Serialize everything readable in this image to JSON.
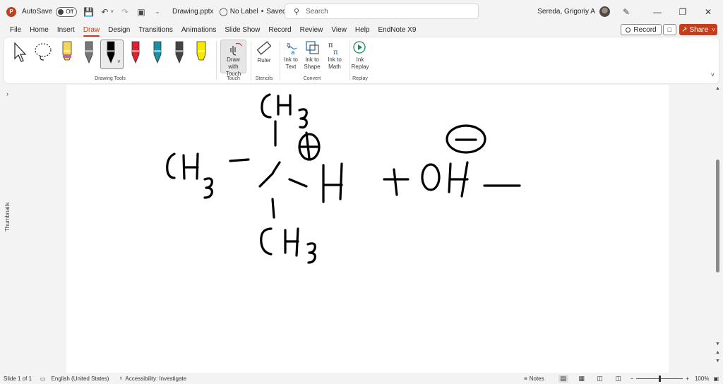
{
  "titlebar": {
    "autosave_label": "AutoSave",
    "autosave_state": "Off",
    "filename": "Drawing.pptx",
    "label": "No Label",
    "separator": "•",
    "saved_status": "Saved to this PC",
    "search_placeholder": "Search",
    "username": "Sereda, Grigoriy A"
  },
  "menu": {
    "tabs": [
      "File",
      "Home",
      "Insert",
      "Draw",
      "Design",
      "Transitions",
      "Animations",
      "Slide Show",
      "Record",
      "Review",
      "View",
      "Help",
      "EndNote X9"
    ],
    "active_tab": "Draw",
    "record_label": "Record",
    "share_label": "Share"
  },
  "ribbon": {
    "groups": {
      "drawing_tools": "Drawing Tools",
      "touch": "Touch",
      "stencils": "Stencils",
      "convert": "Convert",
      "replay": "Replay"
    },
    "buttons": {
      "draw_with_touch": "Draw with Touch",
      "ruler": "Ruler",
      "ink_to_text": "Ink to Text",
      "ink_to_shape": "Ink to Shape",
      "ink_to_math": "Ink to Math",
      "ink_replay": "Ink Replay"
    },
    "pens": [
      "#f4d75a",
      "#777777",
      "#000000",
      "#e02030",
      "#1a8fa6",
      "#444444",
      "#f8e800"
    ]
  },
  "thumbnails": {
    "label": "Thumbnails"
  },
  "statusbar": {
    "slide": "Slide 1 of 1",
    "language": "English (United States)",
    "accessibility": "Accessibility: Investigate",
    "notes": "Notes",
    "zoom": "100%"
  },
  "colors": {
    "accent": "#c43e1c",
    "ink": "#000000"
  }
}
